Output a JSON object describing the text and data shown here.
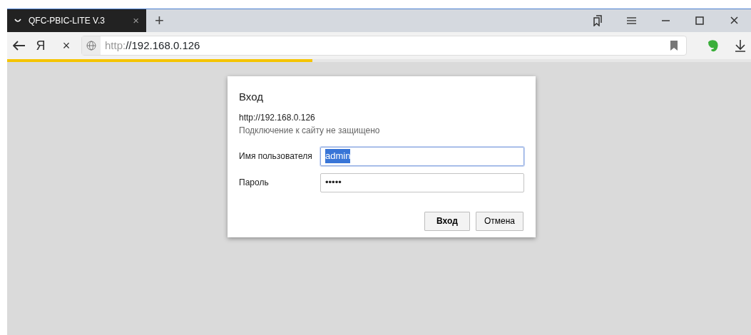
{
  "tab": {
    "title": "QFC-PBIC-LITE V.3",
    "close": "×",
    "selected": true
  },
  "new_tab": "+",
  "toolbar": {
    "home_logo": "Я",
    "stop": "×",
    "address_scheme": "http:",
    "address_rest": "//192.168.0.126"
  },
  "loading": {
    "level": 0.41
  },
  "dialog": {
    "title": "Вход",
    "url": "http://192.168.0.126",
    "warning": "Подключение к сайту не защищено",
    "fields": [
      {
        "label": "Имя пользователя",
        "value": "admin",
        "selected": true,
        "focused": true
      },
      {
        "label": "Пароль",
        "value": "•••••",
        "selected": false,
        "focused": false
      }
    ],
    "buttons": [
      {
        "label": "Вход",
        "default": true
      },
      {
        "label": "Отмена",
        "default": false
      }
    ]
  }
}
